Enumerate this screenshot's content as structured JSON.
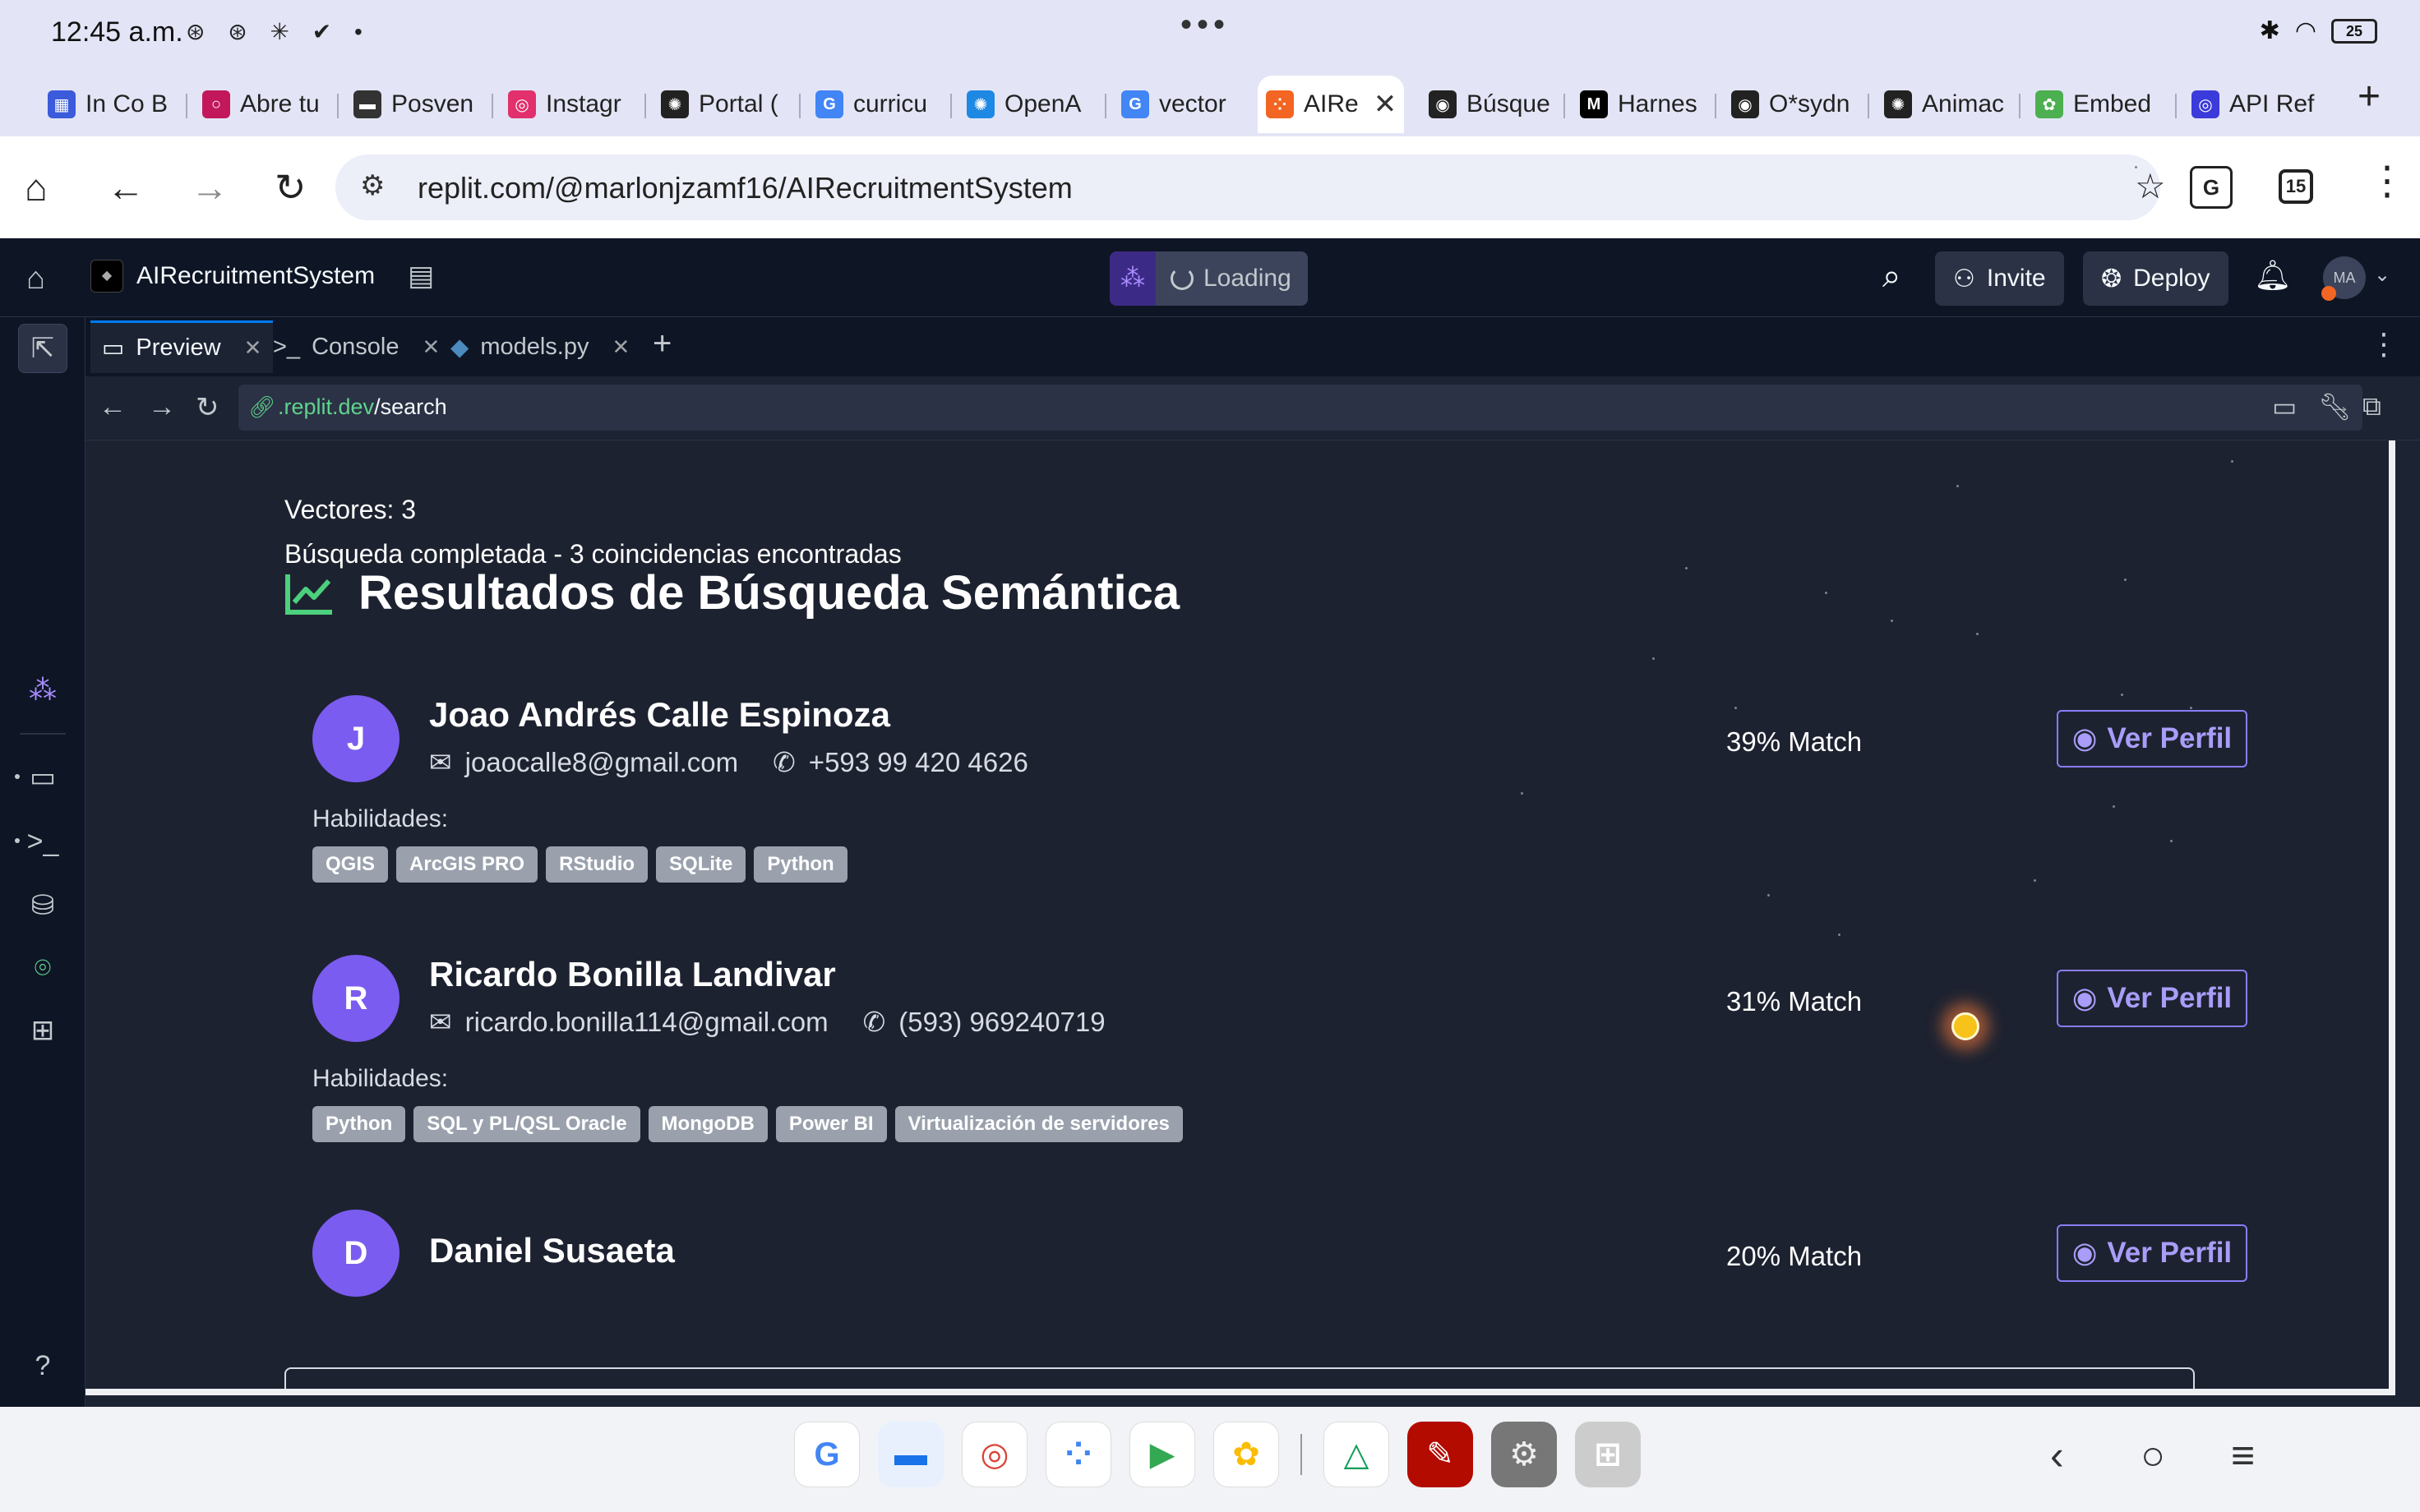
{
  "status_bar": {
    "time": "12:45 a.m.",
    "notifications": "⊛ ⊛ ✳ ✔ •",
    "battery": "25"
  },
  "browser_tabs": [
    {
      "label": "In Co B",
      "fav": "▦",
      "color": "#3b5bdb"
    },
    {
      "label": "Abre tu",
      "fav": "○",
      "color": "#c2185b"
    },
    {
      "label": "Posven",
      "fav": "▬",
      "color": "#333333"
    },
    {
      "label": "Instagr",
      "fav": "◎",
      "color": "#e1306c"
    },
    {
      "label": "Portal (",
      "fav": "✺",
      "color": "#222222"
    },
    {
      "label": "curricu",
      "fav": "G",
      "color": "#4285f4"
    },
    {
      "label": "OpenA",
      "fav": "✺",
      "color": "#1e88e5"
    },
    {
      "label": "vector",
      "fav": "G",
      "color": "#4285f4"
    },
    {
      "label": "AIRe",
      "fav": "⁘",
      "color": "#f26522",
      "active": true
    },
    {
      "label": "Búsque",
      "fav": "◉",
      "color": "#222222"
    },
    {
      "label": "Harnes",
      "fav": "M",
      "color": "#000000"
    },
    {
      "label": "O*sydn",
      "fav": "◉",
      "color": "#222222"
    },
    {
      "label": "Animac",
      "fav": "✺",
      "color": "#222222"
    },
    {
      "label": "Embed",
      "fav": "✿",
      "color": "#4caf50"
    },
    {
      "label": "API Ref",
      "fav": "◎",
      "color": "#3b3bdb"
    }
  ],
  "omnibox": {
    "url": "replit.com/@marlonjzamf16/AIRecruitmentSystem",
    "tab_count": "15"
  },
  "replit": {
    "repo_name": "AIRecruitmentSystem",
    "run_status": "Loading",
    "invite_label": "Invite",
    "deploy_label": "Deploy",
    "avatar_initials": "MA",
    "tabs": [
      {
        "label": "Preview",
        "icon": "monitor-icon"
      },
      {
        "label": "Console",
        "icon": "terminal-icon"
      },
      {
        "label": "models.py",
        "icon": "python-icon"
      }
    ],
    "webview": {
      "url_host": ".replit.dev",
      "url_path": "/search"
    }
  },
  "app": {
    "vectors_line": "Vectores: 3",
    "status_line": "Búsqueda completada - 3 coincidencias encontradas",
    "results_title": "Resultados de Búsqueda Semántica",
    "skills_label": "Habilidades:",
    "view_profile_label": "Ver Perfil",
    "candidates": [
      {
        "initial": "J",
        "name": "Joao Andrés Calle Espinoza",
        "email": "joaocalle8@gmail.com",
        "phone": "+593 99 420 4626",
        "match": "39% Match",
        "skills": [
          "QGIS",
          "ArcGIS PRO",
          "RStudio",
          "SQLite",
          "Python"
        ]
      },
      {
        "initial": "R",
        "name": "Ricardo Bonilla Landivar",
        "email": "ricardo.bonilla114@gmail.com",
        "phone": "(593) 969240719",
        "match": "31% Match",
        "skills": [
          "Python",
          "SQL y PL/QSL Oracle",
          "MongoDB",
          "Power BI",
          "Virtualización de servidores"
        ]
      },
      {
        "initial": "D",
        "name": "Daniel Susaeta",
        "match": "20% Match"
      }
    ]
  },
  "colors": {
    "accent_purple": "#7b5cf0",
    "chart_icon_green": "#4cd07d",
    "replit_bg": "#0e1525"
  }
}
